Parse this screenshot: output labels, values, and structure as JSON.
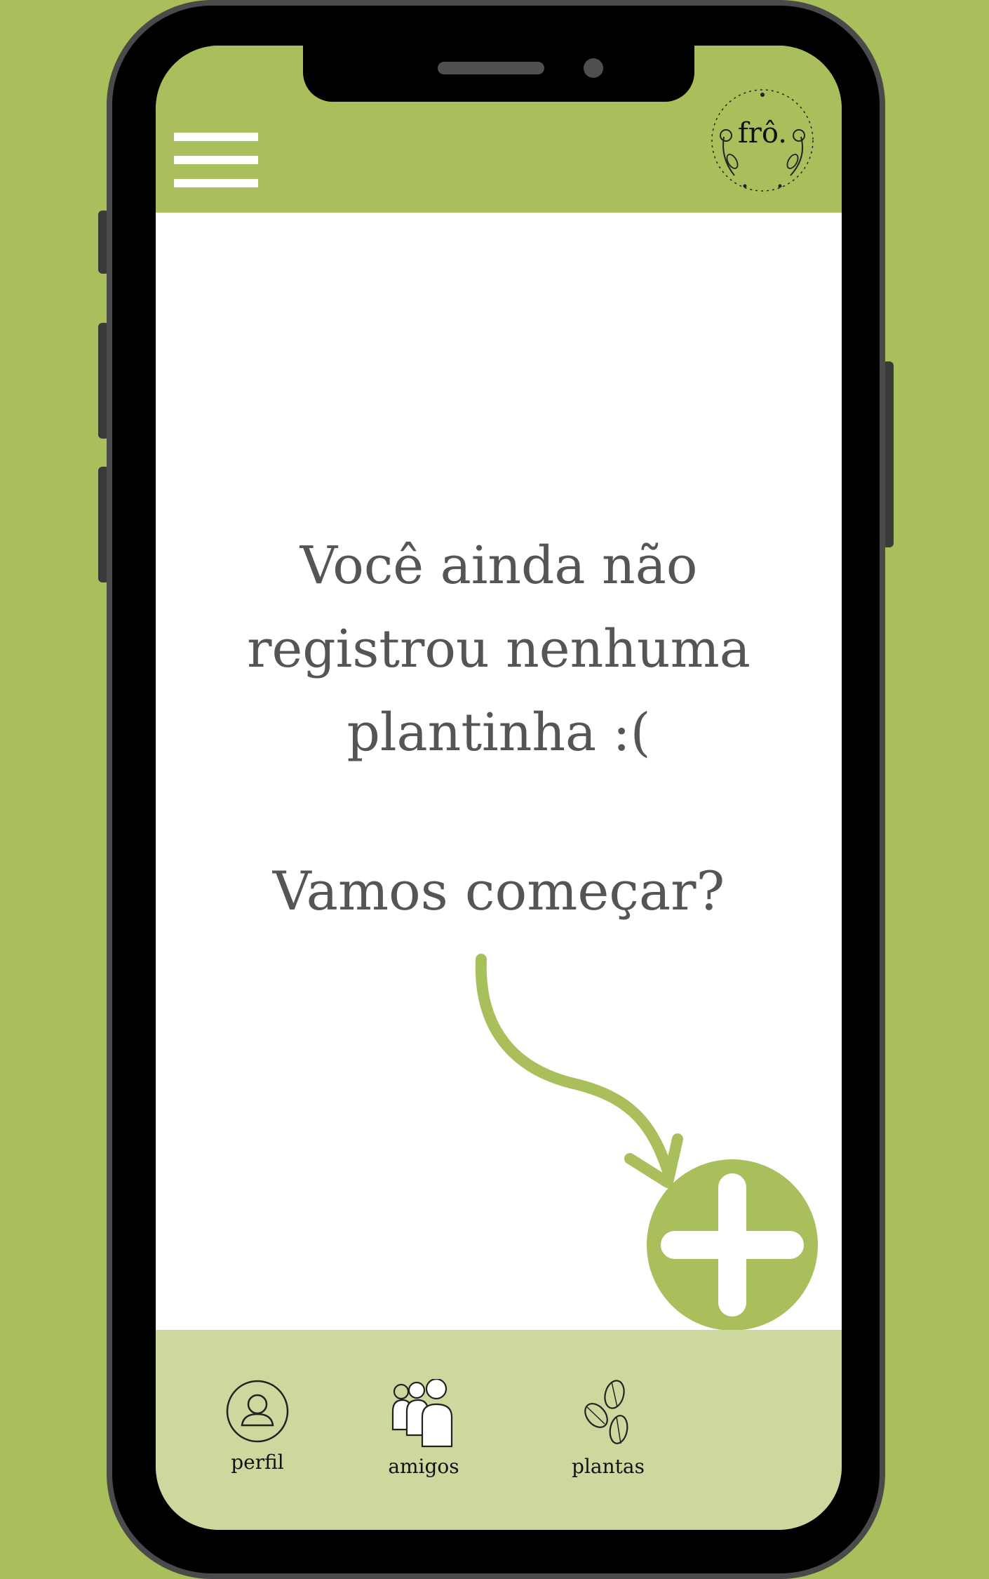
{
  "header": {
    "menu_icon": "hamburger-menu-icon",
    "logo_text": "frô."
  },
  "main": {
    "empty_message_lines": [
      "Você ainda não",
      "registrou nenhuma",
      "plantinha :("
    ],
    "cta": "Vamos começar?",
    "add_button_icon": "plus-icon"
  },
  "bottom_nav": {
    "items": [
      {
        "label": "perfil",
        "icon": "user-profile-icon"
      },
      {
        "label": "amigos",
        "icon": "friends-group-icon"
      },
      {
        "label": "plantas",
        "icon": "leaves-icon"
      }
    ]
  },
  "colors": {
    "accent_green": "#a9bf5b",
    "nav_background": "#ccd89d",
    "text_gray": "#555555",
    "frame": "#000000"
  }
}
